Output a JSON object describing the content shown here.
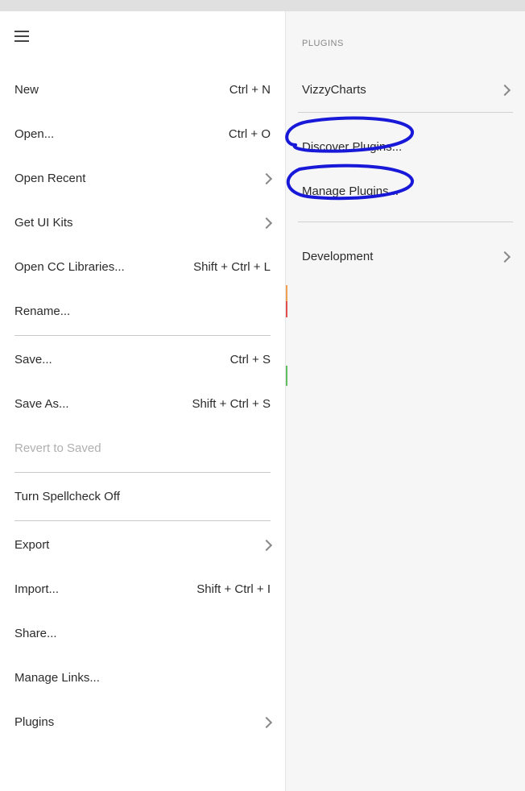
{
  "left_menu": {
    "items": [
      {
        "label": "New",
        "shortcut": "Ctrl + N",
        "has_chevron": false
      },
      {
        "label": "Open...",
        "shortcut": "Ctrl + O",
        "has_chevron": false
      },
      {
        "label": "Open Recent",
        "shortcut": "",
        "has_chevron": true
      },
      {
        "label": "Get UI Kits",
        "shortcut": "",
        "has_chevron": true
      },
      {
        "label": "Open CC Libraries...",
        "shortcut": "Shift + Ctrl + L",
        "has_chevron": false
      },
      {
        "label": "Rename...",
        "shortcut": "",
        "has_chevron": false
      }
    ],
    "group2": [
      {
        "label": "Save...",
        "shortcut": "Ctrl + S",
        "has_chevron": false
      },
      {
        "label": "Save As...",
        "shortcut": "Shift + Ctrl + S",
        "has_chevron": false
      },
      {
        "label": "Revert to Saved",
        "shortcut": "",
        "has_chevron": false,
        "disabled": true
      }
    ],
    "group3": [
      {
        "label": "Turn Spellcheck Off",
        "shortcut": "",
        "has_chevron": false
      }
    ],
    "group4": [
      {
        "label": "Export",
        "shortcut": "",
        "has_chevron": true
      },
      {
        "label": "Import...",
        "shortcut": "Shift + Ctrl + I",
        "has_chevron": false
      },
      {
        "label": "Share...",
        "shortcut": "",
        "has_chevron": false
      },
      {
        "label": "Manage Links...",
        "shortcut": "",
        "has_chevron": false
      },
      {
        "label": "Plugins",
        "shortcut": "",
        "has_chevron": true
      }
    ]
  },
  "right_panel": {
    "header": "PLUGINS",
    "items_top": [
      {
        "label": "VizzyCharts",
        "has_chevron": true
      }
    ],
    "items_mid": [
      {
        "label": "Discover Plugins...",
        "has_chevron": false
      },
      {
        "label": "Manage Plugins...",
        "has_chevron": false
      }
    ],
    "items_bot": [
      {
        "label": "Development",
        "has_chevron": true
      }
    ]
  },
  "annotation_color": "#1818d8"
}
